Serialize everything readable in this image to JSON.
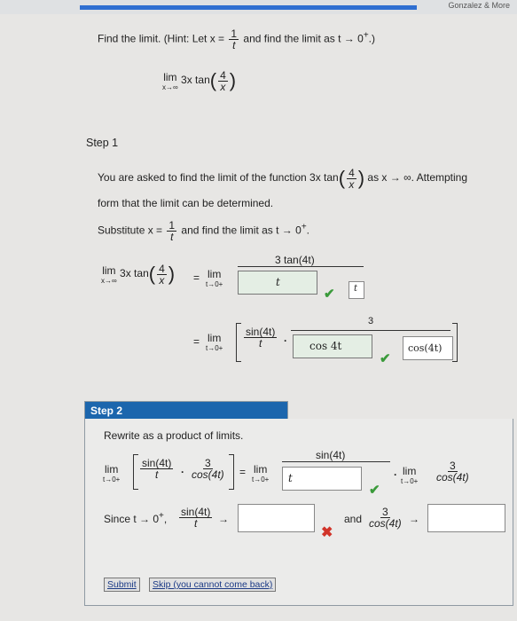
{
  "topbar": {
    "right_text": "Gonzalez & More"
  },
  "question": {
    "text_a": "Find the limit. (Hint: Let x = ",
    "frac_num": "1",
    "frac_den": "t",
    "text_b": " and find the limit as t → 0",
    "sup": "+",
    "text_c": ".)",
    "lim": "lim",
    "lim_sub": "x→∞",
    "expr": "3x tan",
    "inner_num": "4",
    "inner_den": "x"
  },
  "step1": {
    "title": "Step 1",
    "para_a": "You are asked to find the limit of the function 3x tan",
    "para_b": " as x → ∞. Attempting",
    "para_c": "form that the limit can be determined.",
    "sub_a": "Substitute x = ",
    "sub_b": " and find the limit as t → 0",
    "sub_sup": "+",
    "sub_c": ".",
    "lhs_expr": "3x tan",
    "eq": "=",
    "lim": "lim",
    "lim_sub_x": "x→∞",
    "lim_sub_t": "t→0+",
    "numerator": "3 tan(4t)",
    "box1_value": "t",
    "box1_hint": "t",
    "row2_frac_num": "sin(4t)",
    "row2_frac_den": "t",
    "dot": "·",
    "row2_sup": "3",
    "box2_value": "cos 4t",
    "box3_value": "cos(4t)"
  },
  "step2": {
    "title": "Step 2",
    "intro": "Rewrite as a product of limits.",
    "lim": "lim",
    "lim_sub": "t→0+",
    "f1_num": "sin(4t)",
    "f1_den": "t",
    "f2_num": "3",
    "f2_den": "cos(4t)",
    "eq": "=",
    "rhs_num": "sin(4t)",
    "box_value": "t",
    "dot": "·",
    "r_num": "3",
    "r_den": "cos(4t)",
    "since_a": "Since t → 0",
    "since_sup": "+",
    "since_b": ",",
    "s_num": "sin(4t)",
    "s_den": "t",
    "arrow": "→",
    "and": "and",
    "a_num": "3",
    "a_den": "cos(4t)",
    "submit": "Submit",
    "skip": "Skip (you cannot come back)"
  },
  "colors": {
    "header": "#1c66ad",
    "correct": "#3a9a3a",
    "wrong": "#d1342a"
  }
}
